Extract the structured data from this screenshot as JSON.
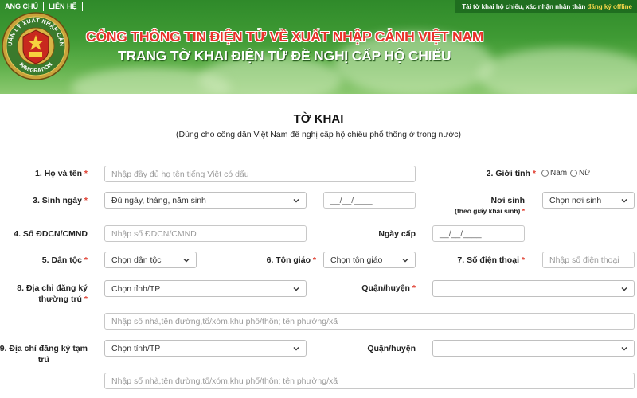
{
  "nav": {
    "home": "ANG CHỦ",
    "contact": "LIÊN HỆ",
    "offline_prefix": "Tải tờ khai hộ chiếu, xác nhận nhân thân",
    "offline_link": "đăng ký offline"
  },
  "emblem": {
    "text_top": "QUẢN LÝ XUẤT NHẬP CẢNH",
    "text_bottom": "IMMIGRATION"
  },
  "header": {
    "title_line1": "CỔNG THÔNG TIN ĐIỆN TỬ VỀ XUẤT NHẬP CẢNH VIỆT NAM",
    "title_line2": "TRANG TỜ KHAI ĐIỆN TỬ ĐỀ NGHỊ CẤP HỘ CHIẾU"
  },
  "form": {
    "title": "TỜ KHAI",
    "subtitle": "(Dùng cho công dân Việt Nam đề nghị cấp hộ chiếu phổ thông ở trong nước)",
    "full_name": {
      "label": "1. Họ và tên",
      "placeholder": "Nhập đầy đủ họ tên tiếng Việt có dấu",
      "value": ""
    },
    "gender": {
      "label": "2. Giới tính",
      "options": [
        "Nam",
        "Nữ"
      ]
    },
    "dob": {
      "label": "3. Sinh ngày",
      "selected": "Đủ ngày, tháng, năm sinh",
      "date_mask": "__/__/____"
    },
    "birthplace": {
      "label": "Nơi sinh",
      "note": "(theo giấy khai sinh)",
      "selected": "Chọn nơi sinh"
    },
    "id_number": {
      "label": "4. Số ĐDCN/CMND",
      "placeholder": "Nhập số ĐDCN/CMND"
    },
    "issue_date": {
      "label": "Ngày cấp",
      "date_mask": "__/__/____"
    },
    "ethnicity": {
      "label": "5. Dân tộc",
      "selected": "Chọn dân tộc"
    },
    "religion": {
      "label": "6. Tôn giáo",
      "selected": "Chọn tôn giáo"
    },
    "phone": {
      "label": "7. Số điện thoại",
      "placeholder": "Nhập số điện thoại"
    },
    "permanent_address": {
      "label_line1": "8. Địa chỉ đăng ký",
      "label_line2": "thường trú",
      "province_selected": "Chọn tỉnh/TP",
      "district_label": "Quận/huyện",
      "district_selected": "",
      "street_placeholder": "Nhập số nhà,tên đường,tổ/xóm,khu phố/thôn; tên phường/xã"
    },
    "temporary_address": {
      "label_line1": "9. Địa chỉ đăng ký tạm",
      "label_line2": "trú",
      "province_selected": "Chọn tỉnh/TP",
      "district_label": "Quận/huyện",
      "district_selected": "",
      "street_placeholder": "Nhập số nhà,tên đường,tổ/xóm,khu phố/thôn; tên phường/xã"
    },
    "required_mark": "*"
  },
  "colors": {
    "header_green": "#3f9a34",
    "title_red": "#e8322a",
    "required_red": "#e03c2e",
    "offline_yellow": "#f5d64a"
  },
  "icons": {
    "dropdown": "chevron-down-icon",
    "emblem": "immigration-emblem-icon"
  }
}
